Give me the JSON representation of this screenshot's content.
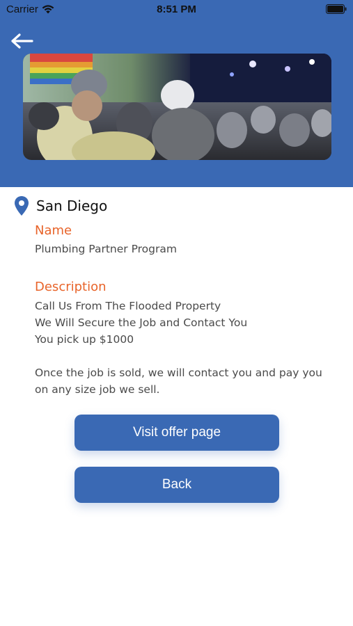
{
  "status_bar": {
    "carrier": "Carrier",
    "time": "8:51 PM"
  },
  "header": {
    "background_color": "#3a69b4",
    "back_icon": "back-arrow-icon",
    "hero_image_icon": "concert-crowd-photo"
  },
  "location": {
    "icon": "location-pin-icon",
    "name": "San Diego"
  },
  "name_section": {
    "label": "Name",
    "value": "Plumbing Partner Program"
  },
  "description_section": {
    "label": "Description",
    "value": "Call Us From The Flooded Property\nWe Will Secure the Job and Contact You\nYou pick up $1000\n\nOnce the job is sold, we will contact you and pay you\non any size job we sell."
  },
  "buttons": {
    "visit_offer": "Visit offer page",
    "back": "Back"
  },
  "colors": {
    "accent": "#3a69b4",
    "label": "#e8642a",
    "text": "#4a4a4a"
  }
}
